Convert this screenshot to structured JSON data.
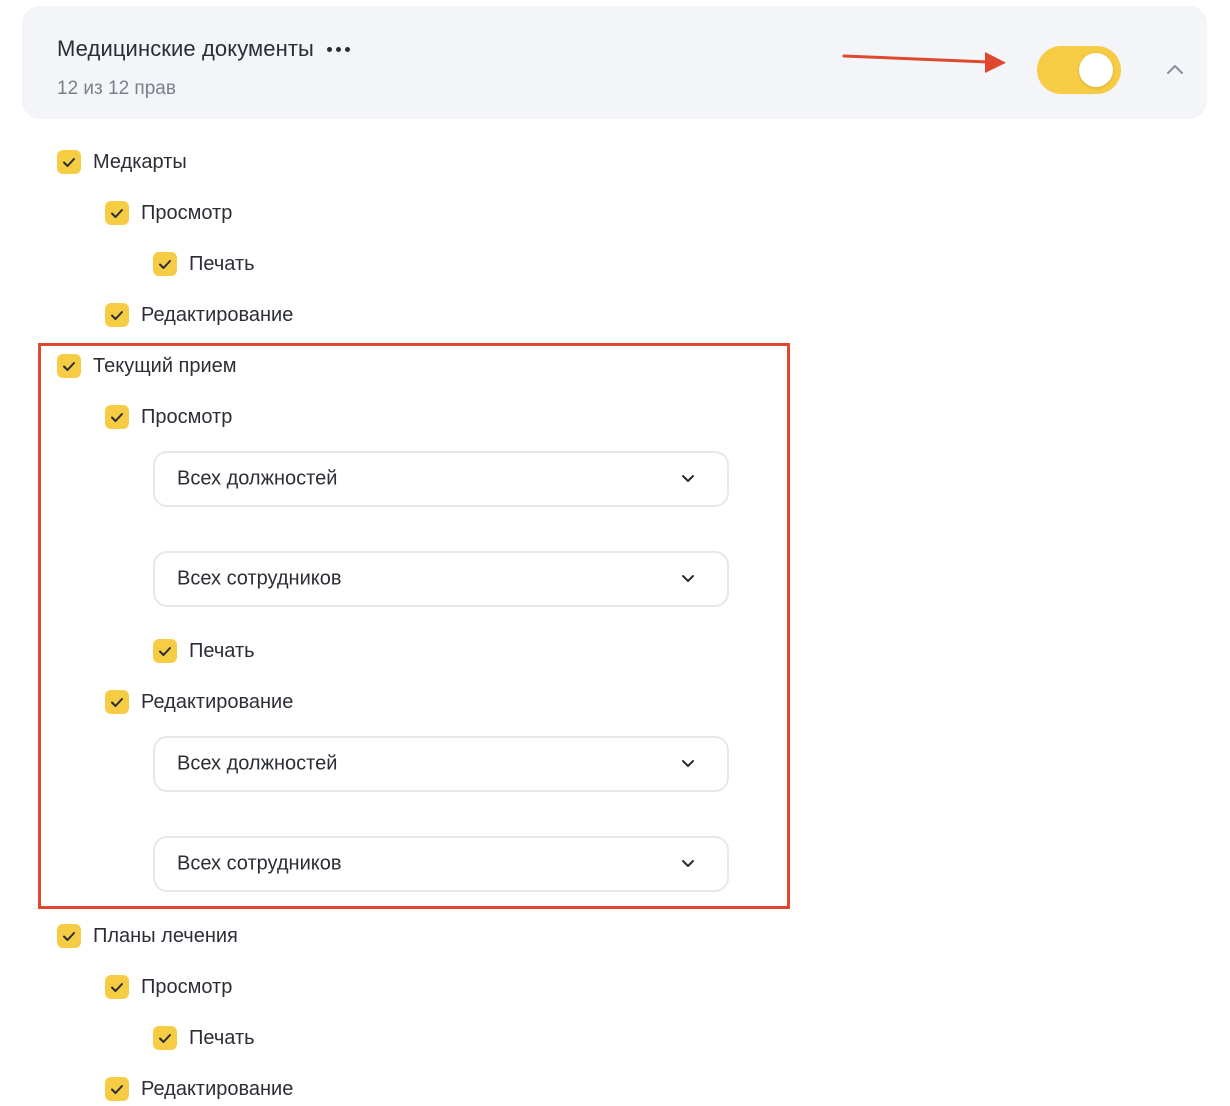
{
  "header": {
    "title": "Медицинские документы",
    "subtitle": "12 из 12 прав",
    "toggle_on": true,
    "accent_color": "#f7cc45"
  },
  "annotations": {
    "color": "#e0472f"
  },
  "permissions": {
    "medcards": {
      "label": "Медкарты",
      "view_label": "Просмотр",
      "print_label": "Печать",
      "edit_label": "Редактирование"
    },
    "current_visit": {
      "label": "Текущий прием",
      "view_label": "Просмотр",
      "view_positions": "Всех должностей",
      "view_employees": "Всех сотрудников",
      "print_label": "Печать",
      "edit_label": "Редактирование",
      "edit_positions": "Всех должностей",
      "edit_employees": "Всех сотрудников"
    },
    "treatment_plans": {
      "label": "Планы лечения",
      "view_label": "Просмотр",
      "print_label": "Печать",
      "edit_label": "Редактирование"
    }
  }
}
